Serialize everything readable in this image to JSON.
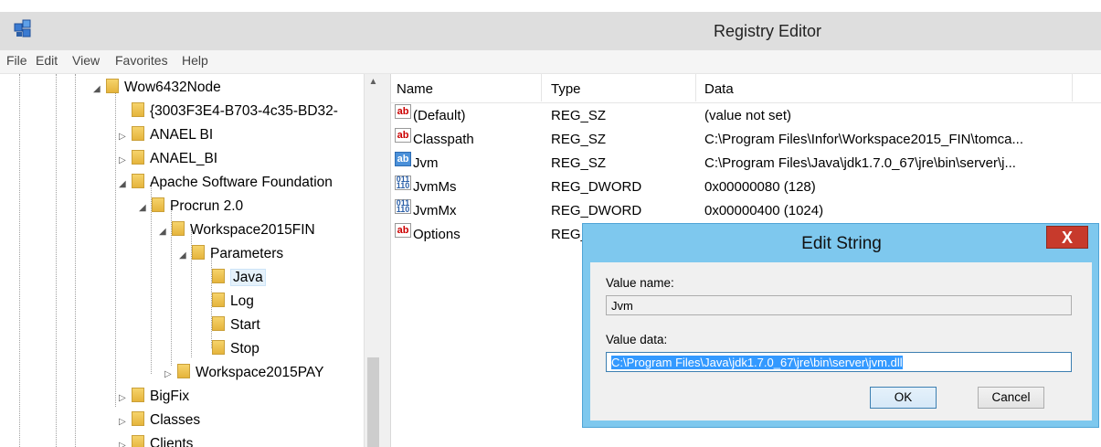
{
  "window": {
    "title": "Registry Editor"
  },
  "menu": [
    "File",
    "Edit",
    "View",
    "Favorites",
    "Help"
  ],
  "tree": [
    {
      "label": "Wow6432Node",
      "expander": "◢",
      "selected": false
    },
    {
      "label": "{3003F3E4-B703-4c35-BD32-",
      "expander": "",
      "selected": false
    },
    {
      "label": "ANAEL BI",
      "expander": "▷",
      "selected": false
    },
    {
      "label": "ANAEL_BI",
      "expander": "▷",
      "selected": false
    },
    {
      "label": "Apache Software Foundation",
      "expander": "◢",
      "selected": false
    },
    {
      "label": "Procrun 2.0",
      "expander": "◢",
      "selected": false
    },
    {
      "label": "Workspace2015FIN",
      "expander": "◢",
      "selected": false
    },
    {
      "label": "Parameters",
      "expander": "◢",
      "selected": false
    },
    {
      "label": "Java",
      "expander": "",
      "selected": true
    },
    {
      "label": "Log",
      "expander": "",
      "selected": false
    },
    {
      "label": "Start",
      "expander": "",
      "selected": false
    },
    {
      "label": "Stop",
      "expander": "",
      "selected": false
    },
    {
      "label": "Workspace2015PAY",
      "expander": "▷",
      "selected": false
    },
    {
      "label": "BigFix",
      "expander": "▷",
      "selected": false
    },
    {
      "label": "Classes",
      "expander": "▷",
      "selected": false
    },
    {
      "label": "Clients",
      "expander": "▷",
      "selected": false
    }
  ],
  "list": {
    "columns": [
      "Name",
      "Type",
      "Data"
    ],
    "rows": [
      {
        "icon": "string-value-icon",
        "name": "(Default)",
        "type": "REG_SZ",
        "data": "(value not set)"
      },
      {
        "icon": "string-value-icon",
        "name": "Classpath",
        "type": "REG_SZ",
        "data": "C:\\Program Files\\Infor\\Workspace2015_FIN\\tomca..."
      },
      {
        "icon": "string-value-icon",
        "name": "Jvm",
        "type": "REG_SZ",
        "data": "C:\\Program Files\\Java\\jdk1.7.0_67\\jre\\bin\\server\\j..."
      },
      {
        "icon": "dword-value-icon",
        "name": "JvmMs",
        "type": "REG_DWORD",
        "data": "0x00000080 (128)"
      },
      {
        "icon": "dword-value-icon",
        "name": "JvmMx",
        "type": "REG_DWORD",
        "data": "0x00000400 (1024)"
      },
      {
        "icon": "string-value-icon",
        "name": "Options",
        "type": "REG_",
        "data": ""
      }
    ]
  },
  "dialog": {
    "title": "Edit String",
    "close": "X",
    "value_name_label": "Value name:",
    "value_name": "Jvm",
    "value_data_label": "Value data:",
    "value_data": "C:\\Program Files\\Java\\jdk1.7.0_67\\jre\\bin\\server\\jvm.dll",
    "ok": "OK",
    "cancel": "Cancel"
  }
}
